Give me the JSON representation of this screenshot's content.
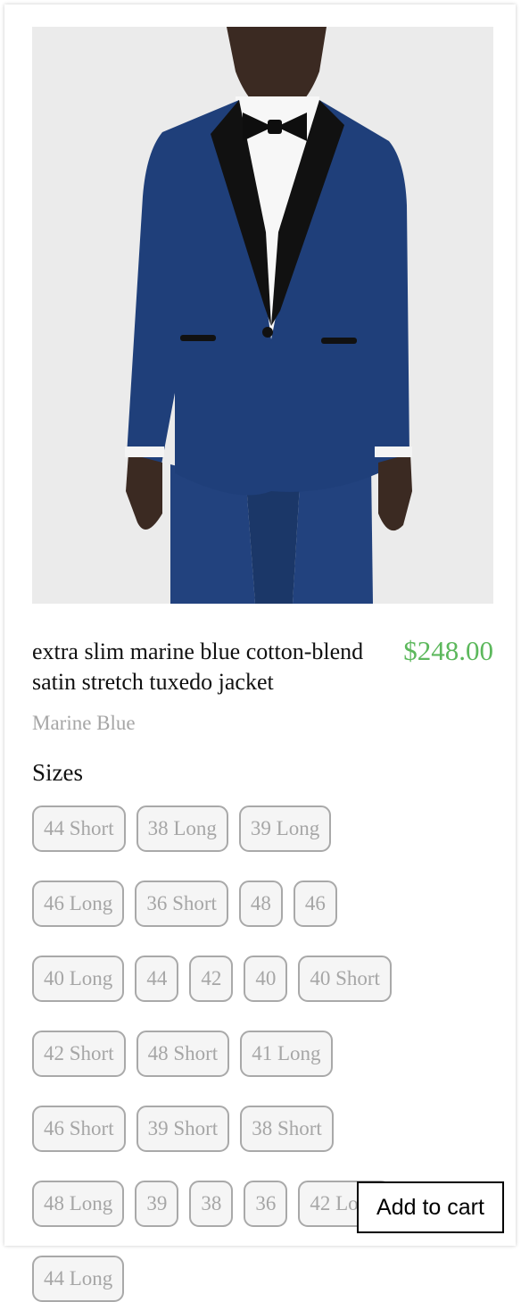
{
  "product": {
    "title": "extra slim marine blue cotton-blend satin stretch tuxedo jacket",
    "price": "$248.00",
    "color": "Marine Blue"
  },
  "sizes": {
    "heading": "Sizes",
    "rows": [
      [
        "44 Short",
        "38 Long",
        "39 Long"
      ],
      [
        "46 Long",
        "36 Short",
        "48",
        "46"
      ],
      [
        "40 Long",
        "44",
        "42",
        "40",
        "40 Short"
      ],
      [
        "42 Short",
        "48 Short",
        "41 Long"
      ],
      [
        "46 Short",
        "39 Short",
        "38 Short"
      ],
      [
        "48 Long",
        "39",
        "38",
        "36",
        "42 Long"
      ],
      [
        "44 Long"
      ]
    ]
  },
  "actions": {
    "add_to_cart_label": "Add to cart"
  },
  "colors": {
    "price": "#5cb85c",
    "jacket": "#1f3f7a",
    "lapel": "#111111"
  }
}
